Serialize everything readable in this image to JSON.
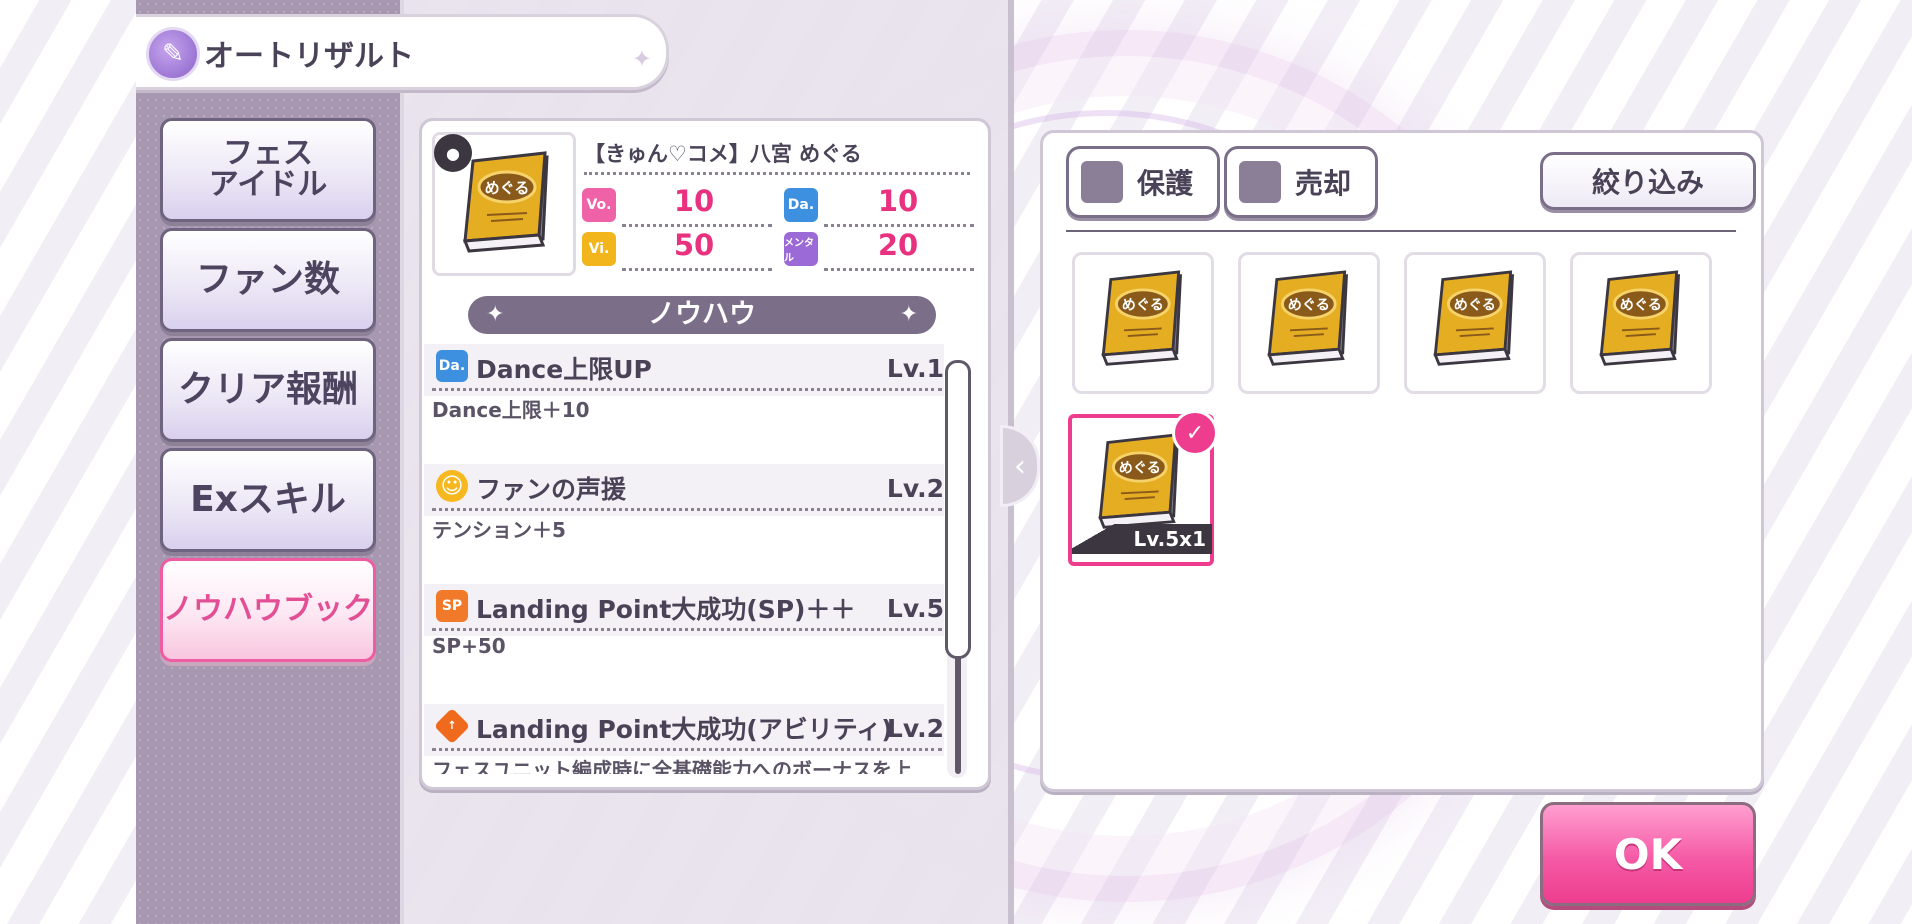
{
  "header": {
    "title": "オートリザルト"
  },
  "nav": {
    "items": [
      {
        "label": "フェス\nアイドル"
      },
      {
        "label": "ファン数"
      },
      {
        "label": "クリア報酬"
      },
      {
        "label": "Exスキル"
      },
      {
        "label": "ノウハウブック"
      }
    ],
    "active_index": 4
  },
  "detail": {
    "name": "【きゅん♡コメ】八宮 めぐる",
    "stats": [
      {
        "badge": "Vo.",
        "value": "10",
        "color": "#f062a8"
      },
      {
        "badge": "Da.",
        "value": "10",
        "color": "#3d8fe0"
      },
      {
        "badge": "Vi.",
        "value": "50",
        "color": "#f2b51b"
      },
      {
        "badge": "メンタル",
        "value": "20",
        "color": "#9c6ad6"
      }
    ],
    "knowhow_title": "ノウハウ",
    "skills": [
      {
        "icon": "Da.",
        "icon_color": "#3d8fe0",
        "name": "Dance上限UP",
        "level": "Lv.1",
        "desc": "Dance上限＋10"
      },
      {
        "icon": "☺",
        "icon_color": "#f6b81e",
        "name": "ファンの声援",
        "level": "Lv.2",
        "desc": "テンション＋5"
      },
      {
        "icon": "SP",
        "icon_color": "#f07a2a",
        "name": "Landing Point大成功(SP)＋＋",
        "level": "Lv.5",
        "desc": "SP+50"
      },
      {
        "icon": "↑",
        "icon_color": "#f06a1e",
        "name": "Landing Point大成功(アビリティ)",
        "level": "Lv.2",
        "desc": "フェスユニット編成時に全基礎能力へのボーナスを上"
      }
    ],
    "scroll_fraction": 0.7
  },
  "inventory": {
    "protect_label": "保護",
    "sell_label": "売却",
    "filter_label": "絞り込み",
    "items": [
      {
        "selected": false
      },
      {
        "selected": false
      },
      {
        "selected": false
      },
      {
        "selected": false
      },
      {
        "selected": true,
        "level_label": "Lv.5x1"
      }
    ]
  },
  "ok_label": "OK",
  "book_title": "めぐる",
  "colors": {
    "accent": "#ee3d8f",
    "panel_border": "#7a6e88",
    "stat_value": "#e8317f"
  }
}
